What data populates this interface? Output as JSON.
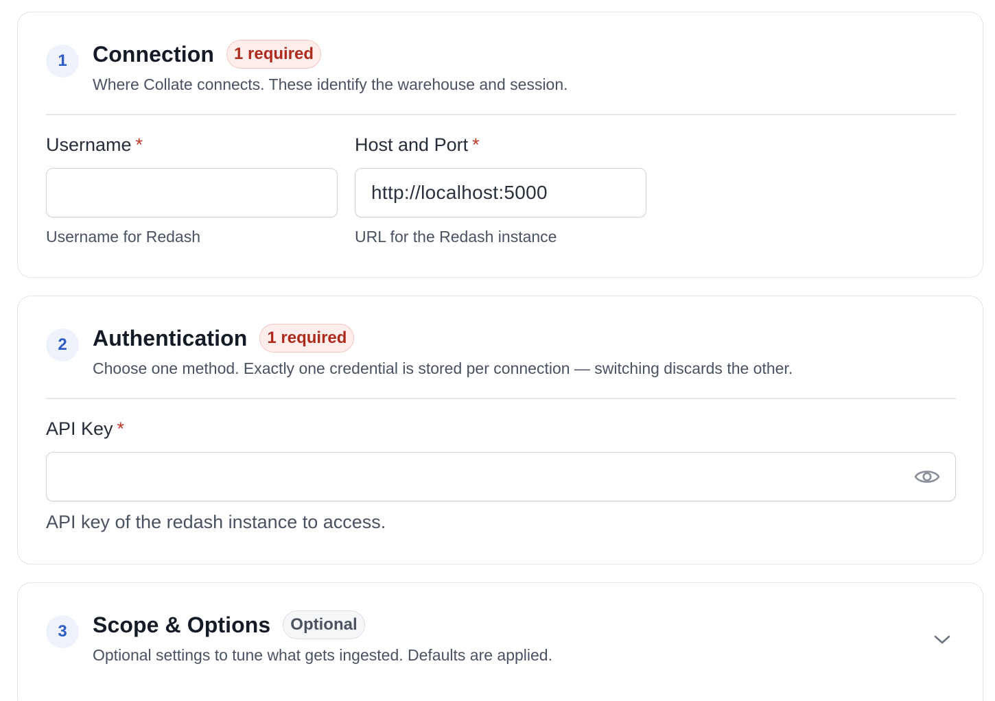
{
  "sections": [
    {
      "step": "1",
      "title": "Connection",
      "badge": "1 required",
      "description": "Where Collate connects. These identify the warehouse and session.",
      "fields": [
        {
          "label": "Username",
          "required_mark": "*",
          "value": "",
          "helper": "Username for Redash"
        },
        {
          "label": "Host and Port",
          "required_mark": "*",
          "value": "http://localhost:5000",
          "helper": "URL for the Redash instance"
        }
      ]
    },
    {
      "step": "2",
      "title": "Authentication",
      "badge": "1 required",
      "description": "Choose one method. Exactly one credential is stored per connection — switching discards the other.",
      "fields": [
        {
          "label": "API Key",
          "required_mark": "*",
          "value": "",
          "helper": "API key of the redash instance to access.",
          "toggle_icon": "eye-icon"
        }
      ]
    },
    {
      "step": "3",
      "title": "Scope & Options",
      "badge": "Optional",
      "description": "Optional settings to tune what gets ingested. Defaults are applied.",
      "expand_icon": "chevron-down-icon"
    }
  ],
  "colors": {
    "required_text": "#ad2a1f",
    "required_bg": "#fdeeec",
    "step_text": "#2f5cc4",
    "step_bg": "#eef3fb"
  }
}
